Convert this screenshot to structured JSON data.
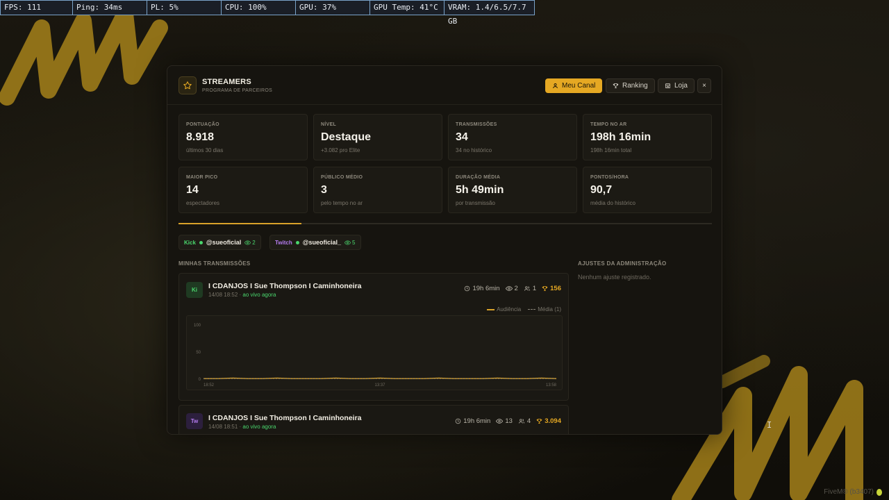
{
  "perf_overlay": {
    "fps": "FPS: 111",
    "ping": "Ping: 34ms",
    "pl": "PL: 5%",
    "cpu": "CPU: 100%",
    "gpu": "GPU: 37%",
    "gpu_temp": "GPU Temp: 41°C",
    "vram": "VRAM: 1.4/6.5/7.7 GB"
  },
  "header": {
    "title": "STREAMERS",
    "subtitle": "PROGRAMA DE PARCEIROS",
    "logo_icon": "star-icon",
    "buttons": {
      "my_channel": "Meu Canal",
      "ranking": "Ranking",
      "shop": "Loja",
      "close": "×"
    }
  },
  "stats": [
    {
      "label": "PONTUAÇÃO",
      "value": "8.918",
      "sub": "últimos 30 dias"
    },
    {
      "label": "NÍVEL",
      "value": "Destaque",
      "sub": "+3.082 pro Elite"
    },
    {
      "label": "TRANSMISSÕES",
      "value": "34",
      "sub": "34 no histórico"
    },
    {
      "label": "TEMPO NO AR",
      "value": "198h 16min",
      "sub": "198h 16min total"
    },
    {
      "label": "MAIOR PICO",
      "value": "14",
      "sub": "espectadores"
    },
    {
      "label": "PÚBLICO MÉDIO",
      "value": "3",
      "sub": "pelo tempo no ar"
    },
    {
      "label": "DURAÇÃO MÉDIA",
      "value": "5h 49min",
      "sub": "por transmissão"
    },
    {
      "label": "PONTOS/HORA",
      "value": "90,7",
      "sub": "média do histórico"
    }
  ],
  "level_progress": 0.23,
  "channels": [
    {
      "platform": "Kick",
      "handle": "@sueoficial",
      "viewers": "2",
      "color": "#4ad66d"
    },
    {
      "platform": "Twitch",
      "handle": "@sueoficial_",
      "viewers": "5",
      "color": "#b57cf0"
    }
  ],
  "sections": {
    "my_streams": "MINHAS TRANSMISSÕES",
    "admin": "AJUSTES DA ADMINISTRAÇÃO",
    "admin_empty": "Nenhum ajuste registrado."
  },
  "streams": [
    {
      "badge": "Ki",
      "badge_color": "#4ad66d",
      "title": "I CDANJOS I Sue Thompson I Caminhoneira",
      "date": "14/08 18:52",
      "live_text": "ao vivo agora",
      "duration": "19h 6min",
      "viewers": "2",
      "peak": "1",
      "points": "156"
    },
    {
      "badge": "Tw",
      "badge_color": "#b57cf0",
      "title": "I CDANJOS I Sue Thompson I Caminhoneira",
      "date": "14/08 18:51",
      "live_text": "ao vivo agora",
      "duration": "19h 6min",
      "viewers": "13",
      "peak": "4",
      "points": "3.094"
    }
  ],
  "chart_legend": {
    "audience": "Audiência",
    "average": "Média (1)"
  },
  "chart_data": {
    "type": "line",
    "x": [
      "18:52",
      "13:37",
      "13:58"
    ],
    "ylim": [
      0,
      100
    ],
    "yticks": [
      100,
      50,
      0
    ],
    "series": [
      {
        "name": "Audiência",
        "values": [
          1,
          1,
          2,
          1,
          1,
          2,
          1,
          1,
          1,
          2,
          1,
          1,
          2,
          1,
          1,
          1,
          2,
          1,
          1,
          1,
          2,
          1,
          1,
          2,
          1
        ]
      },
      {
        "name": "Média (1)",
        "values": [
          1,
          1,
          1,
          1,
          1,
          1,
          1,
          1,
          1,
          1,
          1,
          1,
          1,
          1,
          1,
          1,
          1,
          1,
          1,
          1,
          1,
          1,
          1,
          1,
          1
        ]
      }
    ]
  },
  "footer": {
    "brand": "FiveM® (b3407)"
  }
}
